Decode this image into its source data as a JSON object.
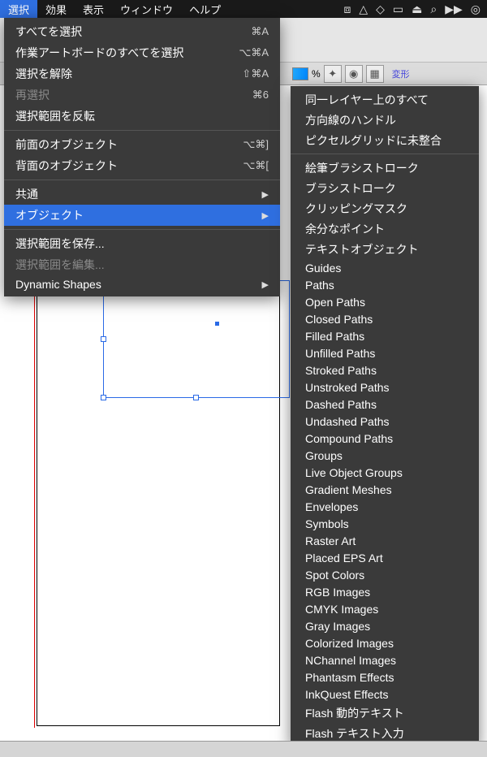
{
  "menubar": {
    "items": [
      "選択",
      "効果",
      "表示",
      "ウィンドウ",
      "ヘルプ"
    ],
    "active_index": 0,
    "tray_icons": [
      "dropbox-icon",
      "gdrive-icon",
      "evernote-icon",
      "tool-icon",
      "lock-icon",
      "search-icon",
      "sync-icon",
      "target-icon"
    ]
  },
  "toolbar": {
    "percent_label": "%",
    "transform_label": "変形"
  },
  "select_menu": {
    "groups": [
      [
        {
          "label": "すべてを選択",
          "shortcut": "⌘A"
        },
        {
          "label": "作業アートボードのすべてを選択",
          "shortcut": "⌥⌘A"
        },
        {
          "label": "選択を解除",
          "shortcut": "⇧⌘A"
        },
        {
          "label": "再選択",
          "shortcut": "⌘6",
          "dim": true
        },
        {
          "label": "選択範囲を反転"
        }
      ],
      [
        {
          "label": "前面のオブジェクト",
          "shortcut": "⌥⌘]"
        },
        {
          "label": "背面のオブジェクト",
          "shortcut": "⌥⌘["
        }
      ],
      [
        {
          "label": "共通",
          "submenu": true
        },
        {
          "label": "オブジェクト",
          "submenu": true,
          "hl": true
        }
      ],
      [
        {
          "label": "選択範囲を保存..."
        },
        {
          "label": "選択範囲を編集...",
          "dim": true
        },
        {
          "label": "Dynamic Shapes",
          "submenu": true
        }
      ]
    ]
  },
  "object_submenu": {
    "groups": [
      [
        "同一レイヤー上のすべて",
        "方向線のハンドル",
        "ピクセルグリッドに未整合"
      ],
      [
        "絵筆ブラシストローク",
        "ブラシストローク",
        "クリッピングマスク",
        "余分なポイント",
        "テキストオブジェクト",
        "Guides",
        "Paths",
        "Open Paths",
        "Closed Paths",
        "Filled Paths",
        "Unfilled Paths",
        "Stroked Paths",
        "Unstroked Paths",
        "Dashed Paths",
        "Undashed Paths",
        "Compound Paths",
        "Groups",
        "Live Object Groups",
        "Gradient Meshes",
        "Envelopes",
        "Symbols",
        "Raster Art",
        "Placed EPS Art",
        "Spot Colors",
        "RGB Images",
        "CMYK Images",
        "Gray Images",
        "Colorized Images",
        "NChannel Images",
        "Phantasm Effects",
        "InkQuest Effects",
        "Flash 動的テキスト",
        "Flash テキスト入力"
      ]
    ]
  }
}
